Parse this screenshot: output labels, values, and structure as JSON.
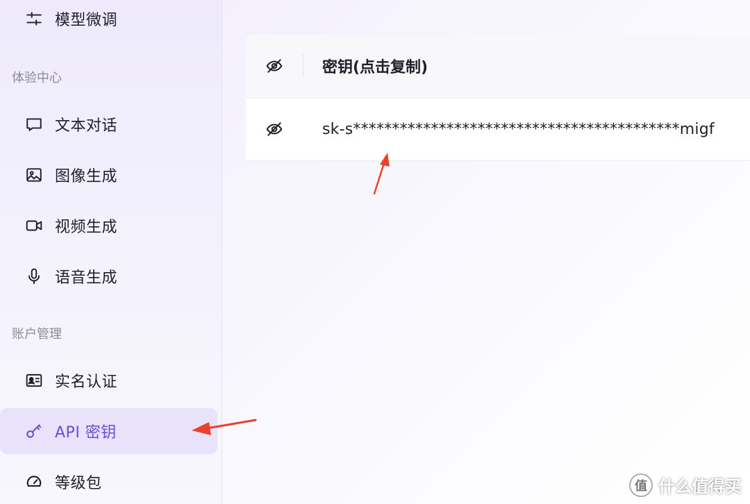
{
  "sidebar": {
    "items": [
      {
        "label": "模型微调",
        "icon": "sliders-icon"
      },
      {
        "label": "文本对话",
        "icon": "chat-bubble-icon"
      },
      {
        "label": "图像生成",
        "icon": "image-icon"
      },
      {
        "label": "视频生成",
        "icon": "video-camera-icon"
      },
      {
        "label": "语音生成",
        "icon": "microphone-icon"
      },
      {
        "label": "实名认证",
        "icon": "id-card-icon"
      },
      {
        "label": "API 密钥",
        "icon": "key-icon",
        "active": true
      },
      {
        "label": "等级包",
        "icon": "gauge-icon"
      }
    ],
    "sections": {
      "experience": "体验中心",
      "account": "账户管理"
    }
  },
  "key_table": {
    "header": "密钥(点击复制)",
    "rows": [
      {
        "key": "sk-s******************************************migf"
      }
    ]
  },
  "watermark": {
    "text": "什么值得买",
    "logo_glyph": "值"
  },
  "colors": {
    "accent": "#6b4bd8",
    "active_bg": "#e8e2fb",
    "annotation_arrow": "#e8412c"
  }
}
